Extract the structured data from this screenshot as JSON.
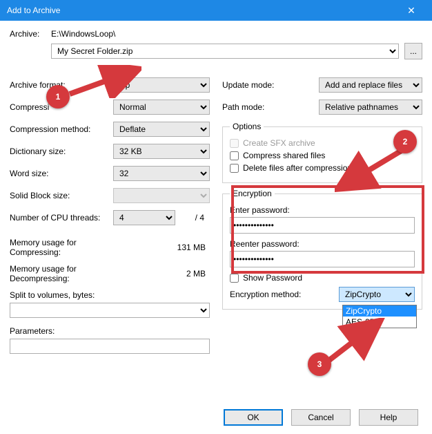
{
  "title": "Add to Archive",
  "archive": {
    "label": "Archive:",
    "path": "E:\\WindowsLoop\\",
    "file": "My Secret Folder.zip",
    "browse": "..."
  },
  "left": {
    "format_label": "Archive format:",
    "format_value": "zip",
    "level_label": "Compressi",
    "level_value": "Normal",
    "method_label": "Compression method:",
    "method_value": "Deflate",
    "dict_label": "Dictionary size:",
    "dict_value": "32 KB",
    "word_label": "Word size:",
    "word_value": "32",
    "solid_label": "Solid Block size:",
    "solid_value": "",
    "cpu_label": "Number of CPU threads:",
    "cpu_value": "4",
    "cpu_total": "/ 4",
    "mem_comp_label": "Memory usage for Compressing:",
    "mem_comp_value": "131 MB",
    "mem_decomp_label": "Memory usage for Decompressing:",
    "mem_decomp_value": "2 MB",
    "split_label": "Split to volumes, bytes:",
    "params_label": "Parameters:"
  },
  "right": {
    "update_label": "Update mode:",
    "update_value": "Add and replace files",
    "path_label": "Path mode:",
    "path_value": "Relative pathnames",
    "options_legend": "Options",
    "sfx_label": "Create SFX archive",
    "compress_shared_label": "Compress shared files",
    "delete_after_label": "Delete files after compression",
    "encryption_legend": "Encryption",
    "enter_pw_label": "Enter password:",
    "reenter_pw_label": "Reenter password:",
    "pw_value": "••••••••••••••",
    "show_pw_label": "Show Password",
    "enc_method_label": "Encryption method:",
    "enc_method_value": "ZipCrypto",
    "enc_options": [
      "ZipCrypto",
      "AES-256"
    ]
  },
  "buttons": {
    "ok": "OK",
    "cancel": "Cancel",
    "help": "Help"
  },
  "annotations": {
    "b1": "1",
    "b2": "2",
    "b3": "3"
  }
}
